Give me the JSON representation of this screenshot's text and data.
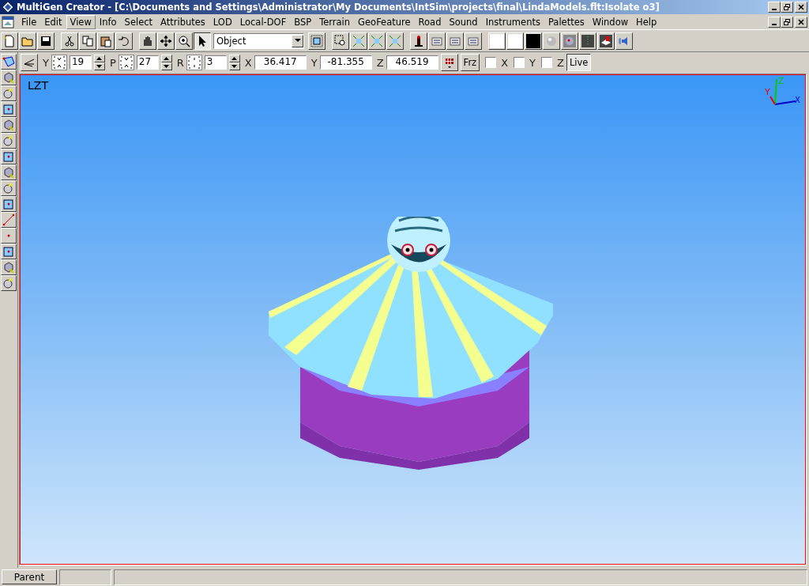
{
  "window": {
    "title": "MultiGen Creator - [C:\\Documents and Settings\\Administrator\\My Documents\\IntSim\\projects\\final\\LindaModels.flt:Isolate o3]"
  },
  "menu": [
    {
      "label": "File",
      "selected": false
    },
    {
      "label": "Edit",
      "selected": false
    },
    {
      "label": "View",
      "selected": true
    },
    {
      "label": "Info",
      "selected": false
    },
    {
      "label": "Select",
      "selected": false
    },
    {
      "label": "Attributes",
      "selected": false
    },
    {
      "label": "LOD",
      "selected": false
    },
    {
      "label": "Local-DOF",
      "selected": false
    },
    {
      "label": "BSP",
      "selected": false
    },
    {
      "label": "Terrain",
      "selected": false
    },
    {
      "label": "GeoFeature",
      "selected": false
    },
    {
      "label": "Road",
      "selected": false
    },
    {
      "label": "Sound",
      "selected": false
    },
    {
      "label": "Instruments",
      "selected": false
    },
    {
      "label": "Palettes",
      "selected": false
    },
    {
      "label": "Window",
      "selected": false
    },
    {
      "label": "Help",
      "selected": false
    }
  ],
  "toolbar": {
    "mode_select": {
      "value": "Object"
    },
    "pointer_selected": true
  },
  "coordinates": {
    "rotations": [
      {
        "label": "Y",
        "value": "19"
      },
      {
        "label": "P",
        "value": "27"
      },
      {
        "label": "R",
        "value": "3"
      }
    ],
    "position": [
      {
        "label": "X",
        "value": "36.417"
      },
      {
        "label": "Y",
        "value": "-81.355"
      },
      {
        "label": "Z",
        "value": "46.519"
      }
    ],
    "freeze_button": "Frz",
    "axis_locks": [
      {
        "label": "X",
        "checked": false
      },
      {
        "label": "Y",
        "checked": false
      },
      {
        "label": "Z",
        "checked": false
      }
    ],
    "live_button": {
      "label": "Live",
      "pressed": true
    }
  },
  "viewport": {
    "label": "LZT",
    "axes": {
      "x": "X",
      "y": "Y",
      "z": "Z"
    }
  },
  "status_bar": {
    "parent_button": "Parent"
  }
}
